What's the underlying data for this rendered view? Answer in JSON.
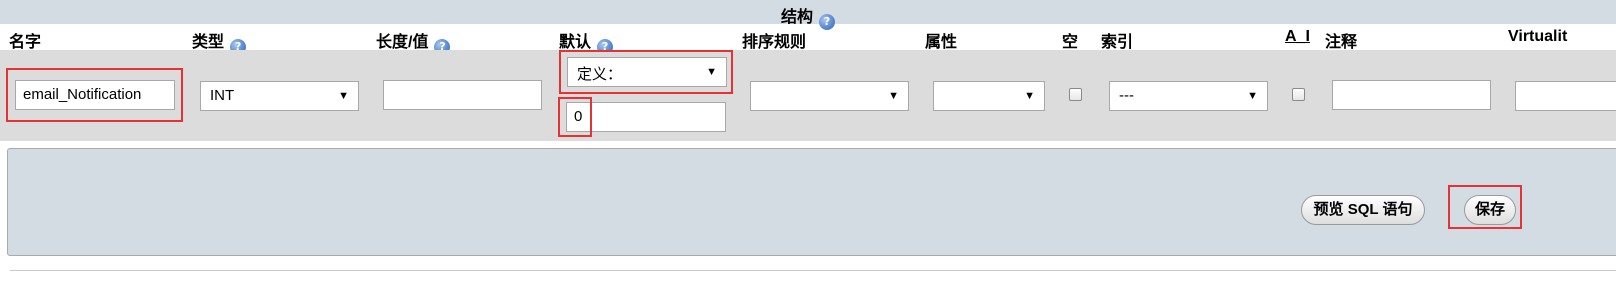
{
  "section": {
    "title": "结构",
    "help": "?"
  },
  "columns": {
    "name": "名字",
    "type": "类型",
    "length": "长度/值",
    "default": "默认",
    "collation": "排序规则",
    "attributes": "属性",
    "null": "空",
    "index": "索引",
    "ai": "A_I",
    "comment": "注释",
    "virtuality": "Virtualit"
  },
  "row": {
    "name_value": "email_Notification",
    "type_value": "INT",
    "length_value": "",
    "default_select": "定义：",
    "default_value": "0",
    "collation_value": "",
    "attributes_value": "",
    "null_checked": false,
    "index_value": "---",
    "ai_checked": false,
    "comment_value": "",
    "virtuality_value": ""
  },
  "actions": {
    "preview_sql": "预览 SQL 语句",
    "save": "保存"
  },
  "icons": {
    "help": "help-icon",
    "dropdown": "dropdown-arrow-icon"
  },
  "colors": {
    "header_band": "#d3dce3",
    "row_band": "#dcdcdc",
    "highlight": "#e53333"
  }
}
